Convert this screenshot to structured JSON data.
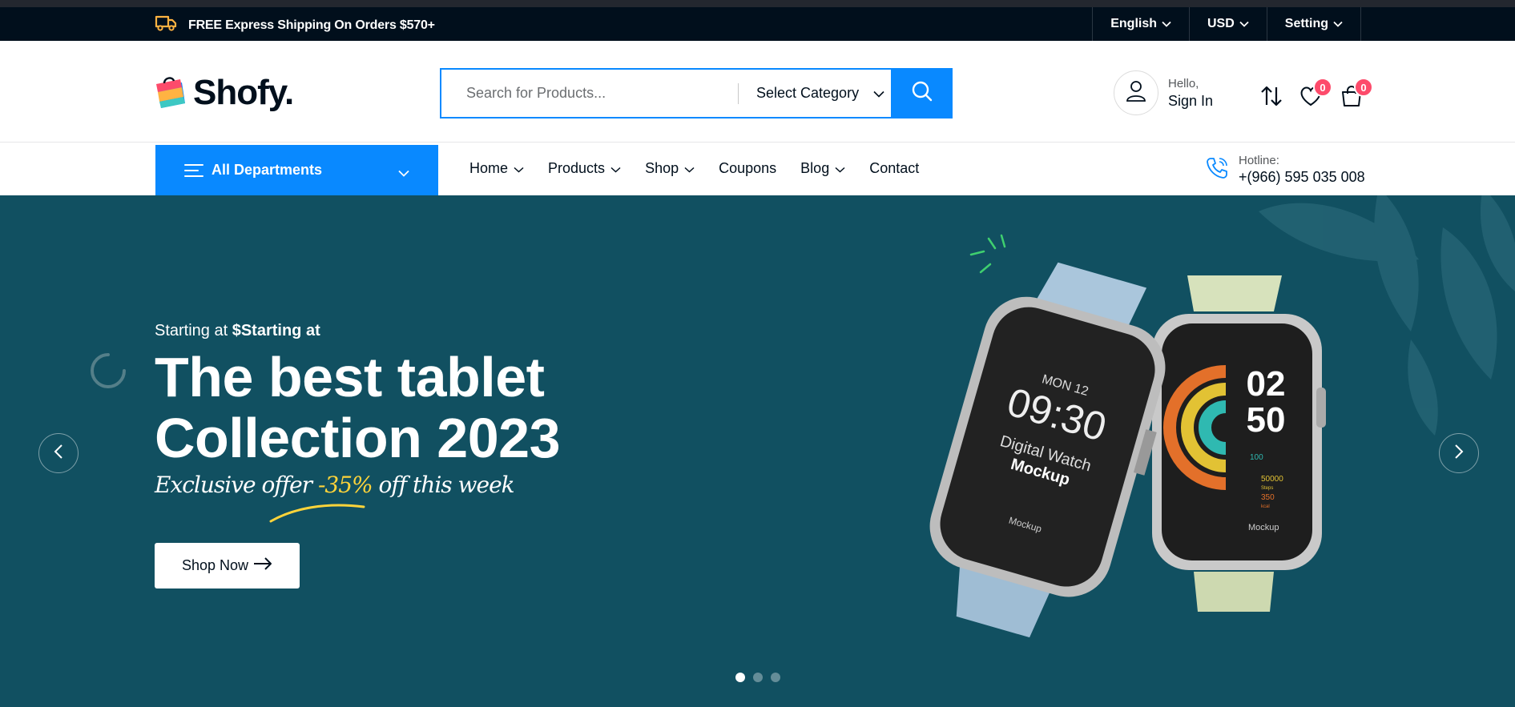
{
  "topbar": {
    "shipping_text": "FREE Express Shipping On Orders $570+",
    "language": "English",
    "currency": "USD",
    "setting": "Setting"
  },
  "header": {
    "logo_text": "Shofy.",
    "search": {
      "placeholder": "Search for Products...",
      "category": "Select Category"
    },
    "account": {
      "greeting": "Hello,",
      "action": "Sign In"
    },
    "wishlist_count": "0",
    "cart_count": "0"
  },
  "nav": {
    "departments_label": "All Departments",
    "items": [
      {
        "label": "Home"
      },
      {
        "label": "Products"
      },
      {
        "label": "Shop"
      },
      {
        "label": "Coupons"
      },
      {
        "label": "Blog"
      },
      {
        "label": "Contact"
      }
    ],
    "hotline_label": "Hotline:",
    "hotline_number": "+(966) 595 035 008"
  },
  "hero": {
    "kicker_prefix": "Starting at ",
    "kicker_bold": "$Starting at",
    "title_line1": "The best tablet",
    "title_line2": "Collection 2023",
    "offer_prefix": "Exclusive offer ",
    "offer_highlight": "-35%",
    "offer_suffix": " off this week",
    "button_label": "Shop Now",
    "watch1": {
      "date": "MON 12",
      "time": "09:30",
      "line1": "Digital Watch",
      "line2": "Mockup",
      "brand": "Mockup"
    },
    "watch2": {
      "hour": "02",
      "minute": "50",
      "stat1": "100",
      "stat2": "50000",
      "stat2_unit": "Steps",
      "stat3": "350",
      "stat3_unit": "kcal",
      "brand": "Mockup"
    },
    "slides": 3,
    "active_slide": 1
  },
  "colors": {
    "brand": "#0989ff",
    "hero_bg": "#115061",
    "topbar_bg": "#010f1c",
    "badge": "#fd4b6b",
    "highlight": "#ffd43a"
  }
}
